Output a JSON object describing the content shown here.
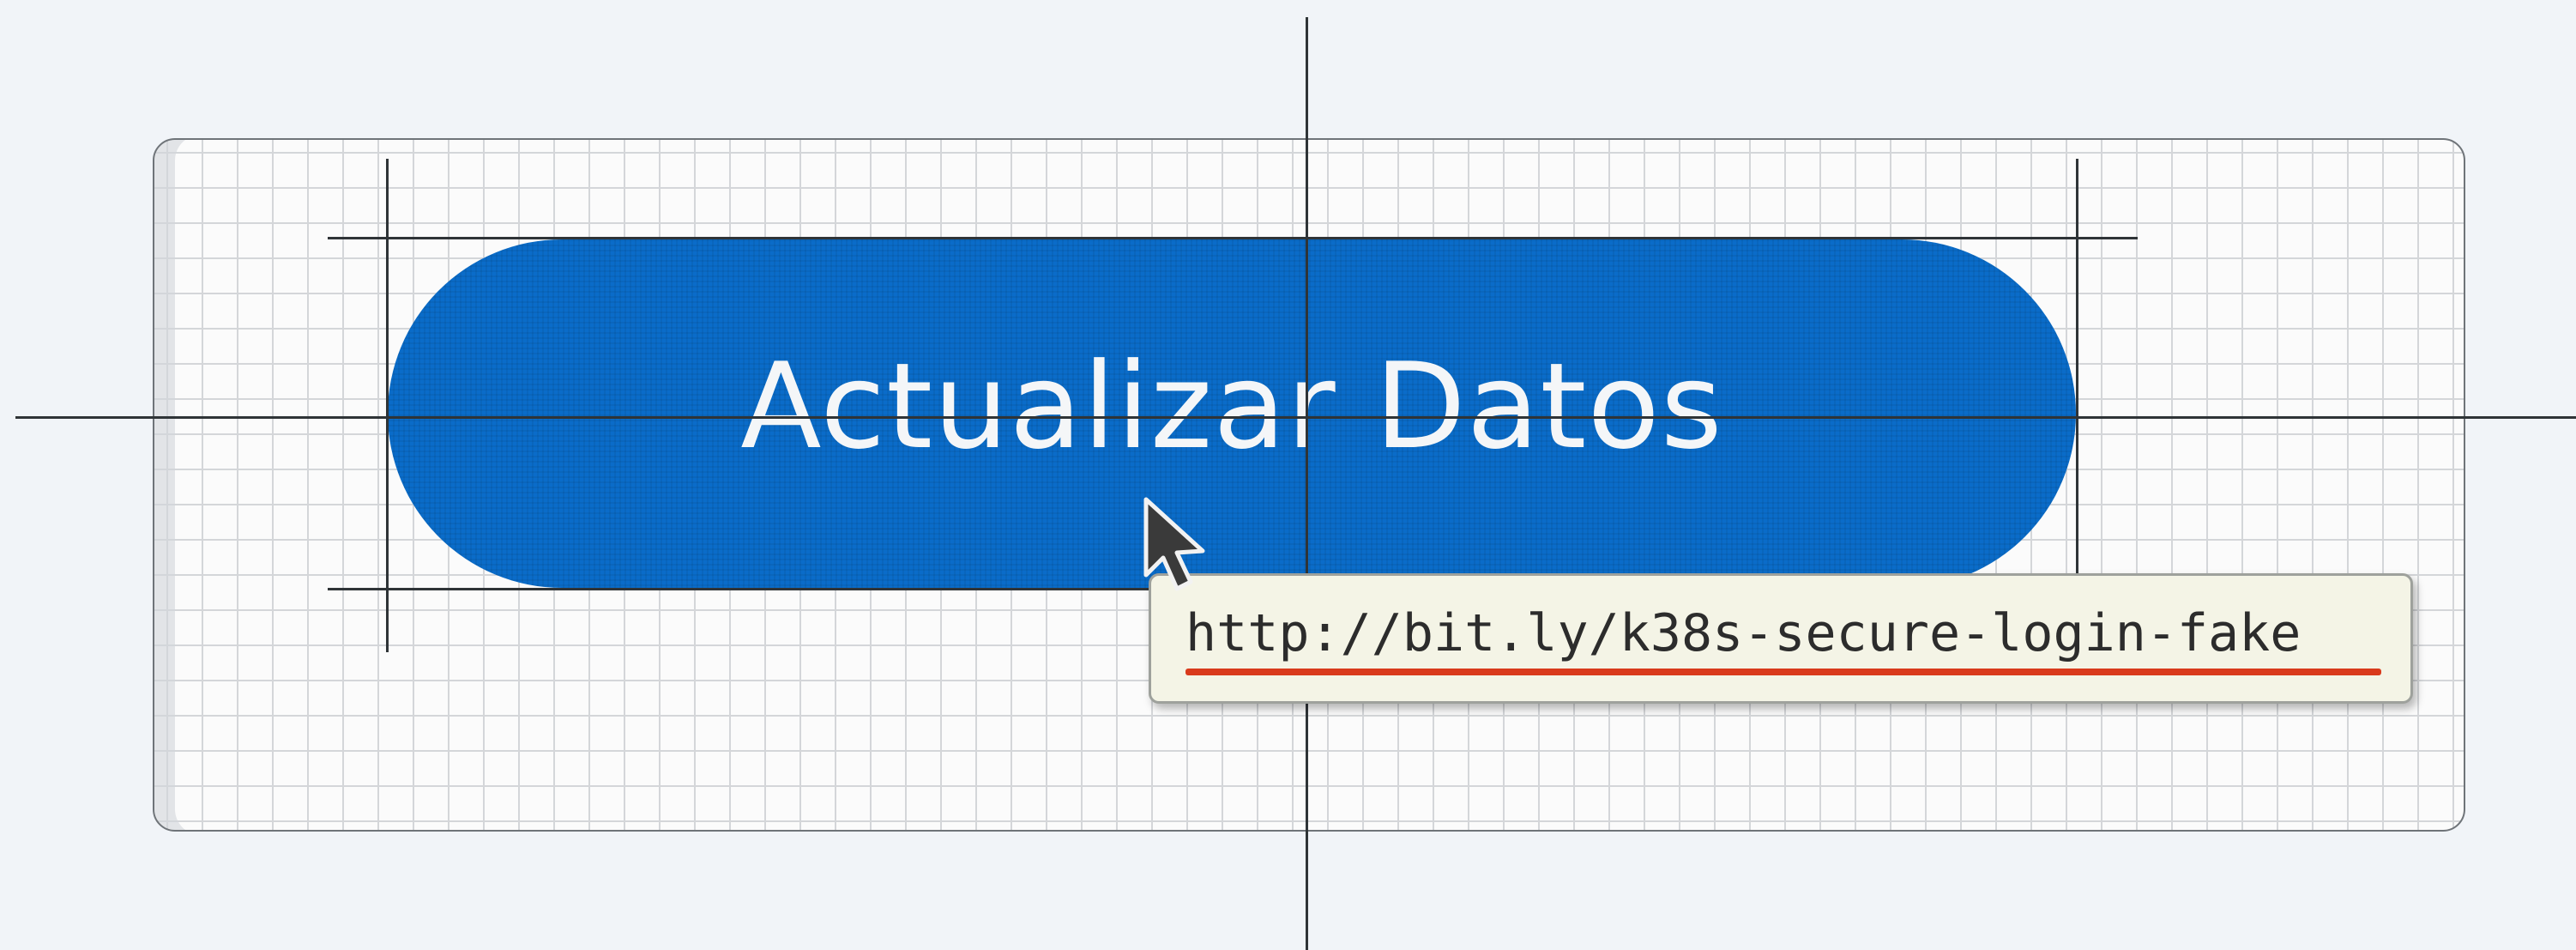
{
  "button": {
    "label": "Actualizar Datos",
    "color": "#0a6cc9",
    "text_color": "#f4f6f8"
  },
  "tooltip": {
    "url": "http://bit.ly/k38s-secure-login-fake",
    "underline_color": "#d93a1c",
    "background": "#f4f4e6"
  },
  "icons": {
    "pointer": "mouse-pointer-arrow-icon"
  }
}
